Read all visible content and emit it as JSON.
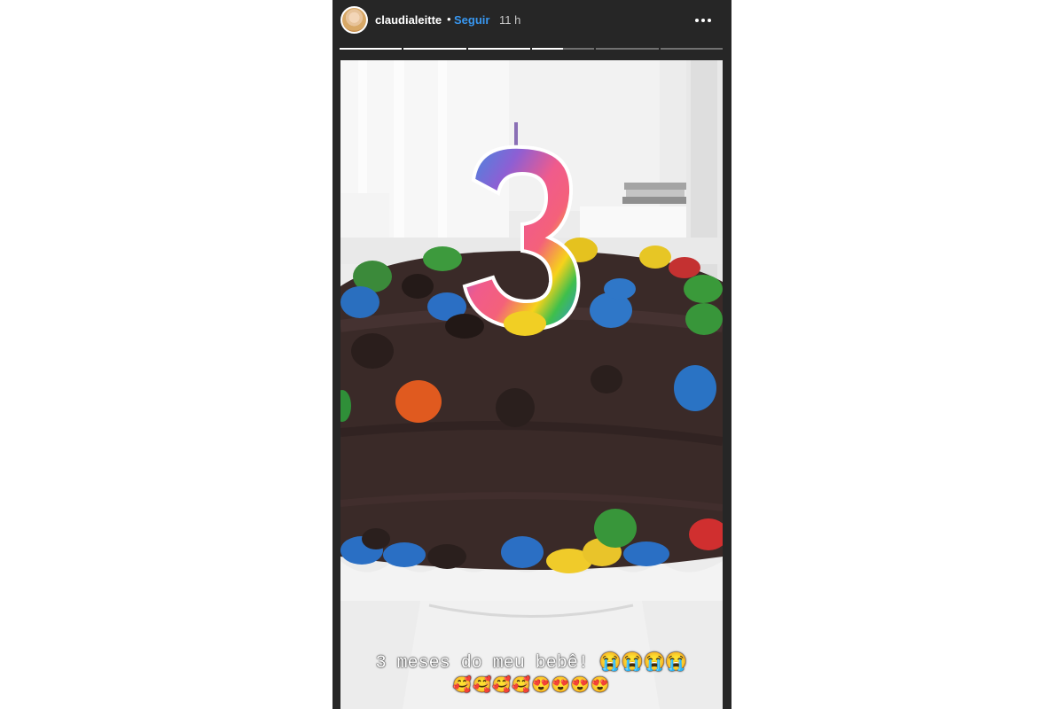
{
  "header": {
    "username": "claudialeitte",
    "separator": "•",
    "follow_label": "Seguir",
    "time_ago": "11 h"
  },
  "progress": {
    "segments": 6,
    "active_index": 3,
    "active_fraction": 0.5
  },
  "media": {
    "caption_line1": "3 meses do meu bebê! 😭😭😭😭",
    "caption_line2": "🥰🥰🥰🥰😍😍😍😍"
  },
  "colors": {
    "frame": "#262626",
    "follow": "#3897f0"
  },
  "icons": {
    "more": "more-options-icon",
    "avatar": "profile-avatar"
  }
}
